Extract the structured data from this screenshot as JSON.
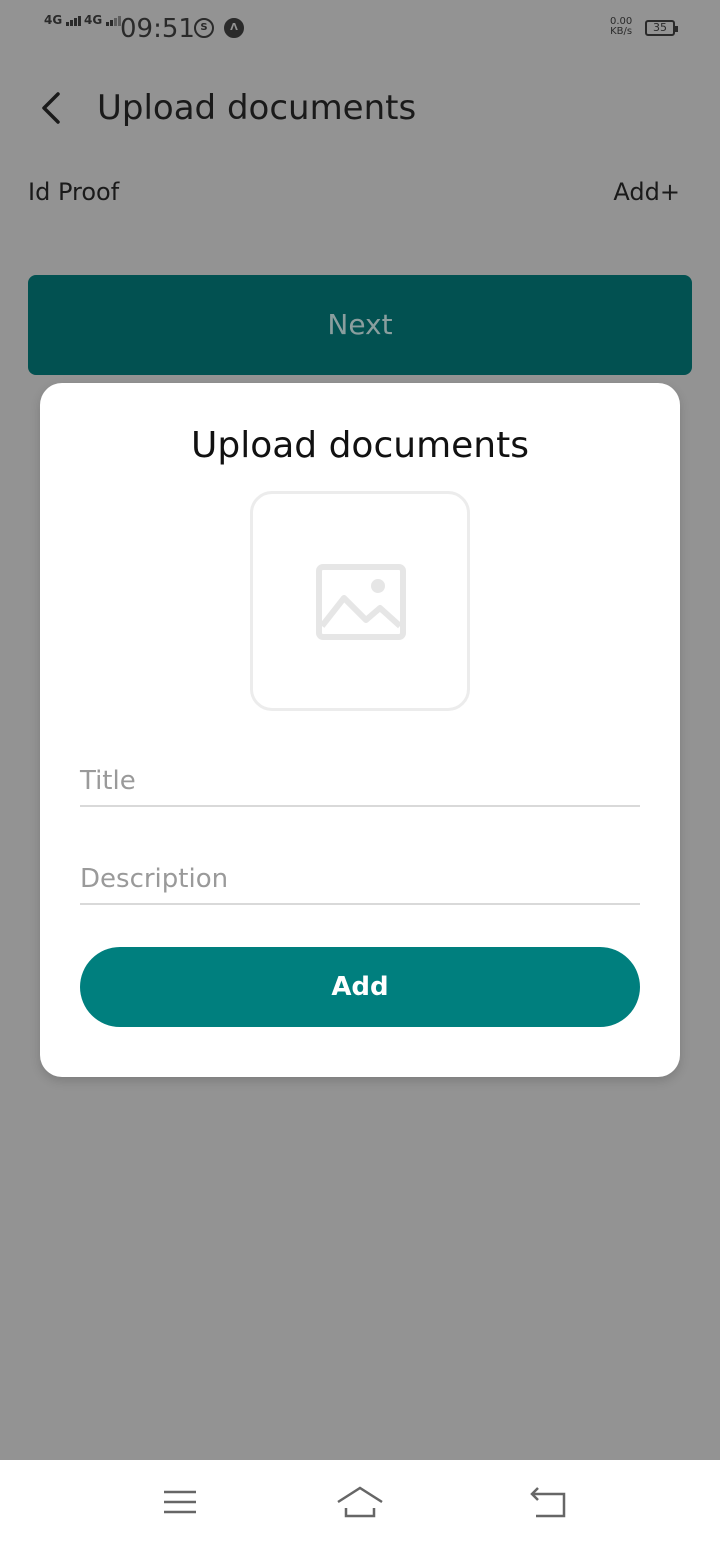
{
  "status_bar": {
    "network1": "4G",
    "network2": "4G",
    "time": "09:51",
    "icon1": "S",
    "speed_value": "0.00",
    "speed_unit": "KB/s",
    "battery": "35"
  },
  "header": {
    "title": "Upload documents"
  },
  "row": {
    "label": "Id Proof",
    "action": "Add+"
  },
  "next_button": "Next",
  "dialog": {
    "title": "Upload documents",
    "image_placeholder_icon": "image-icon",
    "title_placeholder": "Title",
    "description_placeholder": "Description",
    "add_button": "Add"
  },
  "colors": {
    "teal": "#007f7e",
    "dark_teal": "#025151",
    "overlay": "#939393"
  }
}
